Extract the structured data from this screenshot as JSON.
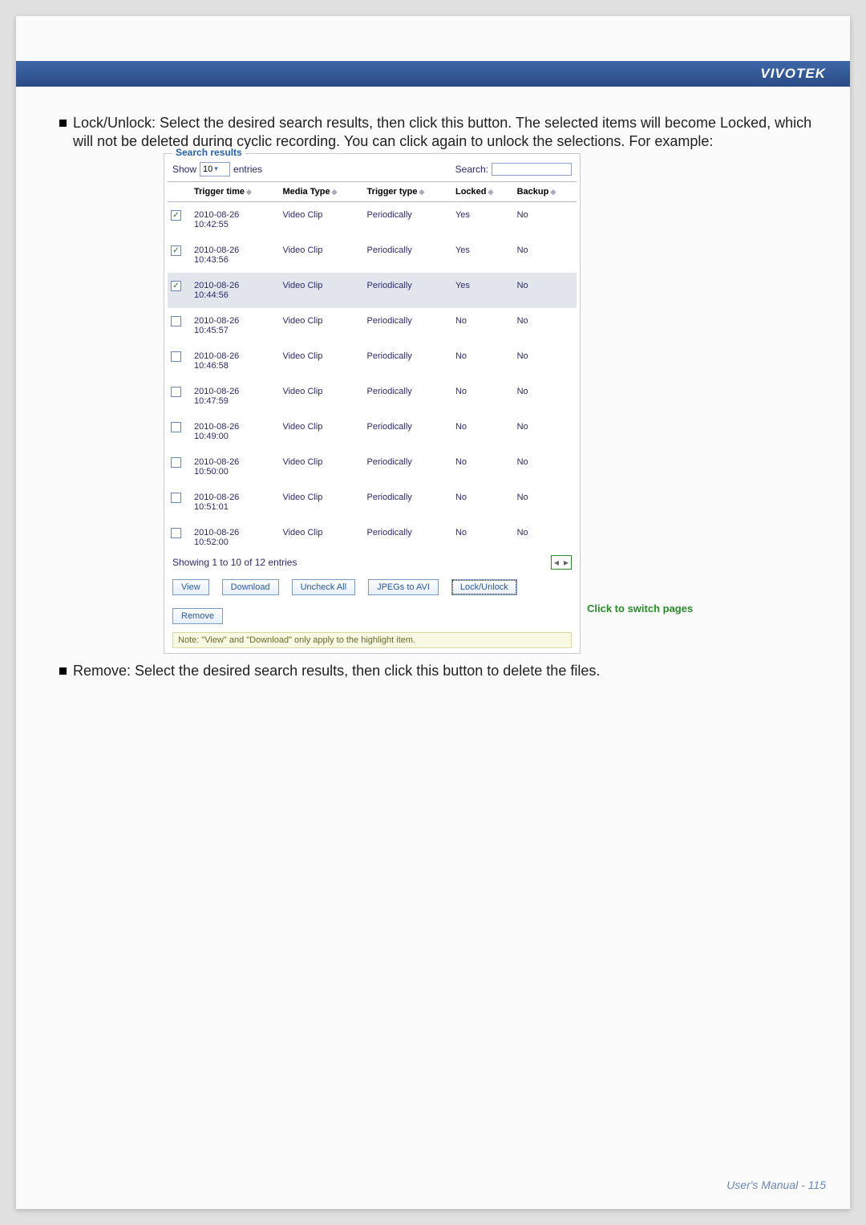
{
  "brand": "VIVOTEK",
  "body": {
    "lock_text": "Lock/Unlock: Select the desired search results, then click this button. The selected items will become Locked, which will not be deleted during cyclic recording. You can click again to unlock the selections. For example:",
    "remove_text": "Remove: Select the desired search results, then click this button to delete the files."
  },
  "panel": {
    "legend": "Search results",
    "show_label": "Show",
    "show_value": "10",
    "entries_label": "entries",
    "search_label": "Search:",
    "headers": {
      "trigger_time": "Trigger time",
      "media_type": "Media Type",
      "trigger_type": "Trigger type",
      "locked": "Locked",
      "backup": "Backup"
    },
    "rows": [
      {
        "checked": true,
        "sel": false,
        "time": "2010-08-26 10:42:55",
        "media": "Video Clip",
        "type": "Periodically",
        "locked": "Yes",
        "backup": "No"
      },
      {
        "checked": true,
        "sel": false,
        "time": "2010-08-26 10:43:56",
        "media": "Video Clip",
        "type": "Periodically",
        "locked": "Yes",
        "backup": "No"
      },
      {
        "checked": true,
        "sel": true,
        "time": "2010-08-26 10:44:56",
        "media": "Video Clip",
        "type": "Periodically",
        "locked": "Yes",
        "backup": "No"
      },
      {
        "checked": false,
        "sel": false,
        "time": "2010-08-26 10:45:57",
        "media": "Video Clip",
        "type": "Periodically",
        "locked": "No",
        "backup": "No"
      },
      {
        "checked": false,
        "sel": false,
        "time": "2010-08-26 10:46:58",
        "media": "Video Clip",
        "type": "Periodically",
        "locked": "No",
        "backup": "No"
      },
      {
        "checked": false,
        "sel": false,
        "time": "2010-08-26 10:47:59",
        "media": "Video Clip",
        "type": "Periodically",
        "locked": "No",
        "backup": "No"
      },
      {
        "checked": false,
        "sel": false,
        "time": "2010-08-26 10:49:00",
        "media": "Video Clip",
        "type": "Periodically",
        "locked": "No",
        "backup": "No"
      },
      {
        "checked": false,
        "sel": false,
        "time": "2010-08-26 10:50:00",
        "media": "Video Clip",
        "type": "Periodically",
        "locked": "No",
        "backup": "No"
      },
      {
        "checked": false,
        "sel": false,
        "time": "2010-08-26 10:51:01",
        "media": "Video Clip",
        "type": "Periodically",
        "locked": "No",
        "backup": "No"
      },
      {
        "checked": false,
        "sel": false,
        "time": "2010-08-26 10:52:00",
        "media": "Video Clip",
        "type": "Periodically",
        "locked": "No",
        "backup": "No"
      }
    ],
    "entries_summary": "Showing 1 to 10 of 12 entries",
    "buttons": {
      "view": "View",
      "download": "Download",
      "uncheck": "Uncheck All",
      "jpegs": "JPEGs to AVI",
      "lock": "Lock/Unlock",
      "remove": "Remove"
    },
    "note": "Note: \"View\" and \"Download\" only apply to the highlight item.",
    "switch_note": "Click to switch pages"
  },
  "footer": "User's Manual - 115"
}
